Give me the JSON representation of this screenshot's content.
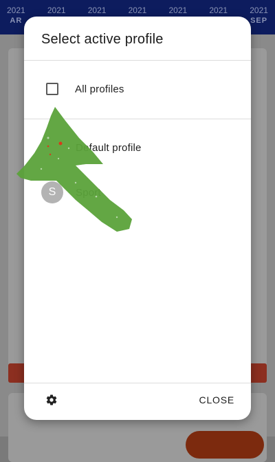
{
  "background": {
    "months": [
      {
        "year": "2021",
        "month": "AR"
      },
      {
        "year": "2021",
        "month": ""
      },
      {
        "year": "2021",
        "month": ""
      },
      {
        "year": "2021",
        "month": ""
      },
      {
        "year": "2021",
        "month": ""
      },
      {
        "year": "2021",
        "month": ""
      },
      {
        "year": "2021",
        "month": "SEP"
      }
    ]
  },
  "dialog": {
    "title": "Select active profile",
    "all_profiles_label": "All profiles",
    "profiles": [
      {
        "initial": "",
        "name": "Default profile"
      },
      {
        "initial": "S",
        "name": "Sport"
      }
    ],
    "close_label": "CLOSE"
  },
  "icons": {
    "settings": "gear-icon",
    "checkbox": "checkbox-unchecked-icon"
  },
  "colors": {
    "appbar": "#0d1c5e",
    "arrow": "#5ba23a",
    "avatar": "#b3b3b3"
  }
}
